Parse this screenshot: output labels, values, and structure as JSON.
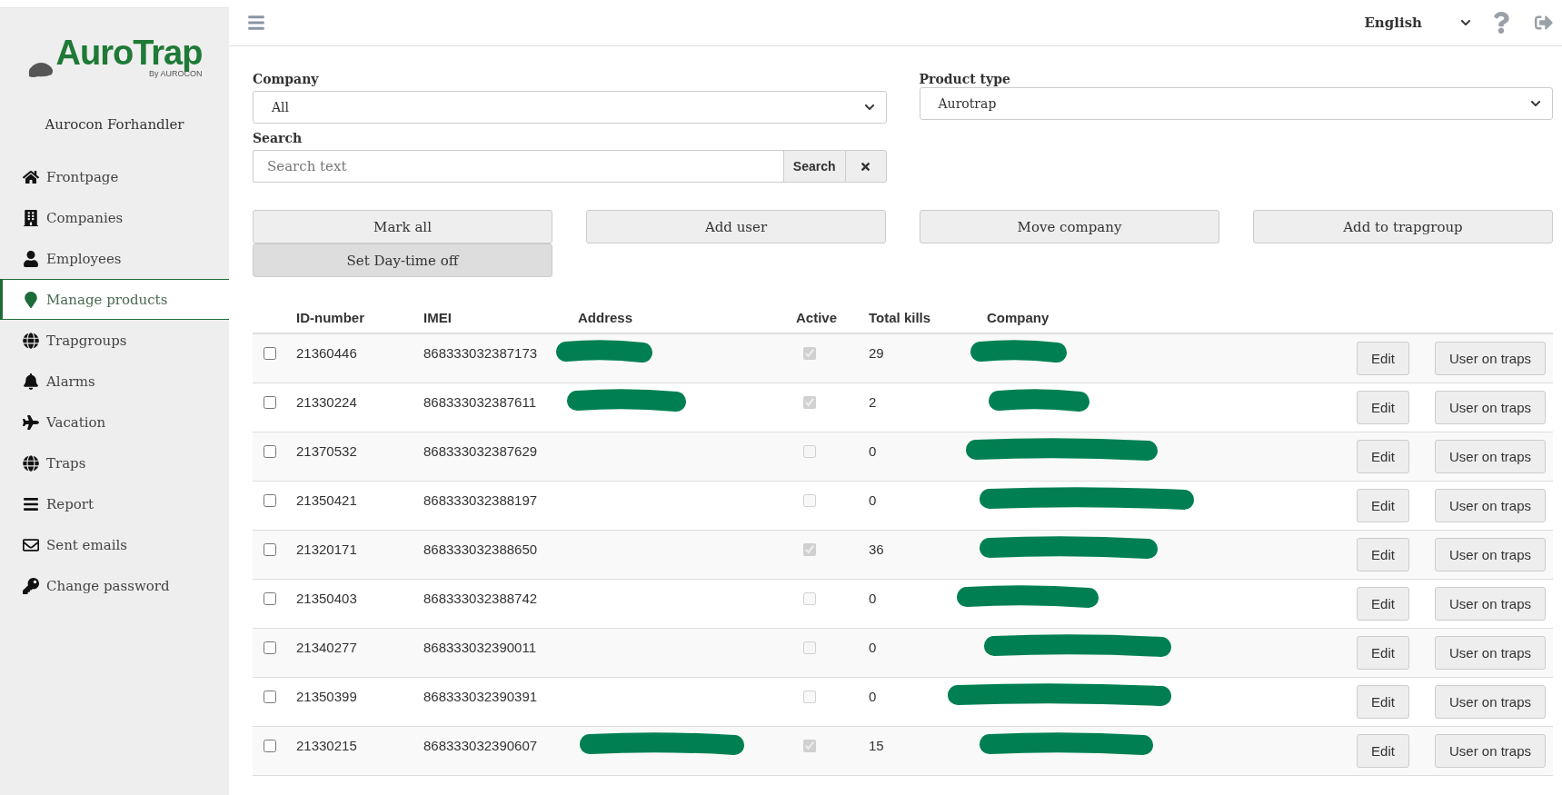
{
  "header": {
    "language": "English"
  },
  "sidebar": {
    "logo": {
      "name": "AuroTrap",
      "tagline": "By AUROCON"
    },
    "account": "Aurocon Forhandler",
    "items": [
      {
        "label": "Frontpage",
        "selected": false
      },
      {
        "label": "Companies",
        "selected": false
      },
      {
        "label": "Employees",
        "selected": false
      },
      {
        "label": "Manage products",
        "selected": true
      },
      {
        "label": "Trapgroups",
        "selected": false
      },
      {
        "label": "Alarms",
        "selected": false
      },
      {
        "label": "Vacation",
        "selected": false
      },
      {
        "label": "Traps",
        "selected": false
      },
      {
        "label": "Report",
        "selected": false
      },
      {
        "label": "Sent emails",
        "selected": false
      },
      {
        "label": "Change password",
        "selected": false
      }
    ]
  },
  "filters": {
    "company": {
      "label": "Company",
      "value": "All"
    },
    "product_type": {
      "label": "Product type",
      "value": "Aurotrap"
    },
    "search": {
      "label": "Search",
      "placeholder": "Search text",
      "button": "Search"
    }
  },
  "actions": [
    "Mark all",
    "Add user",
    "Move company",
    "Add to trapgroup",
    "Set Day-time off"
  ],
  "table": {
    "columns": [
      "ID-number",
      "IMEI",
      "Address",
      "Active",
      "Total kills",
      "Company"
    ],
    "rows": [
      {
        "selected": false,
        "id": "21360446",
        "imei": "868333032387173",
        "address_redacted": true,
        "active": true,
        "total_kills": "29",
        "company_redacted": true,
        "edit": "Edit",
        "users": "User on traps"
      },
      {
        "selected": false,
        "id": "21330224",
        "imei": "868333032387611",
        "address_redacted": true,
        "active": true,
        "total_kills": "2",
        "company_redacted": true,
        "edit": "Edit",
        "users": "User on traps"
      },
      {
        "selected": false,
        "id": "21370532",
        "imei": "868333032387629",
        "address_redacted": false,
        "active": false,
        "total_kills": "0",
        "company_redacted": true,
        "edit": "Edit",
        "users": "User on traps"
      },
      {
        "selected": false,
        "id": "21350421",
        "imei": "868333032388197",
        "address_redacted": false,
        "active": false,
        "total_kills": "0",
        "company_redacted": true,
        "edit": "Edit",
        "users": "User on traps"
      },
      {
        "selected": false,
        "id": "21320171",
        "imei": "868333032388650",
        "address_redacted": false,
        "active": true,
        "total_kills": "36",
        "company_redacted": true,
        "edit": "Edit",
        "users": "User on traps"
      },
      {
        "selected": false,
        "id": "21350403",
        "imei": "868333032388742",
        "address_redacted": false,
        "active": false,
        "total_kills": "0",
        "company_redacted": true,
        "edit": "Edit",
        "users": "User on traps"
      },
      {
        "selected": false,
        "id": "21340277",
        "imei": "868333032390011",
        "address_redacted": false,
        "active": false,
        "total_kills": "0",
        "company_redacted": true,
        "edit": "Edit",
        "users": "User on traps"
      },
      {
        "selected": false,
        "id": "21350399",
        "imei": "868333032390391",
        "address_redacted": false,
        "active": false,
        "total_kills": "0",
        "company_redacted": true,
        "edit": "Edit",
        "users": "User on traps"
      },
      {
        "selected": false,
        "id": "21330215",
        "imei": "868333032390607",
        "address_redacted": true,
        "active": true,
        "total_kills": "15",
        "company_redacted": true,
        "edit": "Edit",
        "users": "User on traps"
      }
    ]
  }
}
